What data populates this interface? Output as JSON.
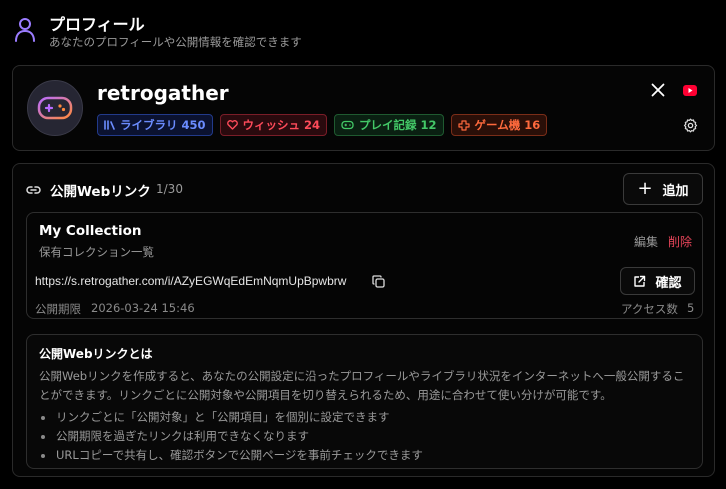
{
  "header": {
    "icon": "user-icon",
    "title": "プロフィール",
    "subtitle": "あなたのプロフィールや公開情報を確認できます"
  },
  "profile": {
    "avatar_icon": "gamepad-icon",
    "username": "retrogather",
    "badges": [
      {
        "icon": "library-icon",
        "label": "ライブラリ 450",
        "color": "#6b8cff"
      },
      {
        "icon": "heart-icon",
        "label": "ウィッシュ 24",
        "color": "#ff4b5a"
      },
      {
        "icon": "gamepad-icon",
        "label": "プレイ記録 12",
        "color": "#43c867"
      },
      {
        "icon": "console-icon",
        "label": "ゲーム機 16",
        "color": "#ff6a3d"
      }
    ],
    "social": [
      "x-icon",
      "youtube-icon"
    ],
    "settings_icon": "gear-icon"
  },
  "public_links": {
    "icon": "link-icon",
    "title": "公開Webリンク",
    "count": "1/30",
    "add_label": "追加",
    "items": [
      {
        "title": "My Collection",
        "description": "保有コレクション一覧",
        "edit_label": "編集",
        "delete_label": "削除",
        "url": "https://s.retrogather.com/i/AZyEGWqEdEmNqmUpBpwbrw",
        "confirm_label": "確認",
        "expiry_label": "公開期限",
        "expiry_value": "2026-03-24 15:46",
        "access_label": "アクセス数",
        "access_value": "5"
      }
    ],
    "info": {
      "title": "公開Webリンクとは",
      "body": "公開Webリンクを作成すると、あなたの公開設定に沿ったプロフィールやライブラリ状況をインターネットへ一般公開することができます。リンクごとに公開対象や公開項目を切り替えられるため、用途に合わせて使い分けが可能です。",
      "bullets": [
        "リンクごとに「公開対象」と「公開項目」を個別に設定できます",
        "公開期限を過ぎたリンクは利用できなくなります",
        "URLコピーで共有し、確認ボタンで公開ページを事前チェックできます"
      ]
    }
  }
}
